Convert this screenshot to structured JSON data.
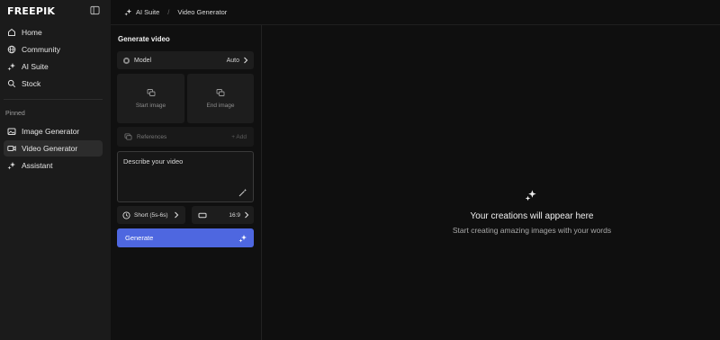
{
  "app": {
    "logo": "FREEPIK"
  },
  "sidebar": {
    "nav": [
      {
        "label": "Home",
        "icon": "home-icon"
      },
      {
        "label": "Community",
        "icon": "globe-icon"
      },
      {
        "label": "AI Suite",
        "icon": "sparkle-icon"
      },
      {
        "label": "Stock",
        "icon": "search-icon"
      }
    ],
    "pinned_label": "Pinned",
    "pinned": [
      {
        "label": "Image Generator",
        "icon": "image-icon"
      },
      {
        "label": "Video Generator",
        "icon": "video-icon",
        "active": true
      },
      {
        "label": "Assistant",
        "icon": "sparkle-icon"
      }
    ]
  },
  "breadcrumb": {
    "root": "AI Suite",
    "separator": "/",
    "current": "Video Generator"
  },
  "panel": {
    "title": "Generate video",
    "model_label": "Model",
    "model_value": "Auto",
    "start_image": "Start image",
    "end_image": "End image",
    "references_label": "References",
    "references_add": "+ Add",
    "prompt_placeholder": "Describe your video",
    "duration": "Short (5s-6s)",
    "aspect_ratio": "16:9",
    "generate": "Generate"
  },
  "empty_state": {
    "title": "Your creations will appear here",
    "subtitle": "Start creating amazing images with your words"
  },
  "colors": {
    "accent": "#4e67e0",
    "background": "#0f0f0f",
    "sidebar": "#1b1b1b"
  }
}
